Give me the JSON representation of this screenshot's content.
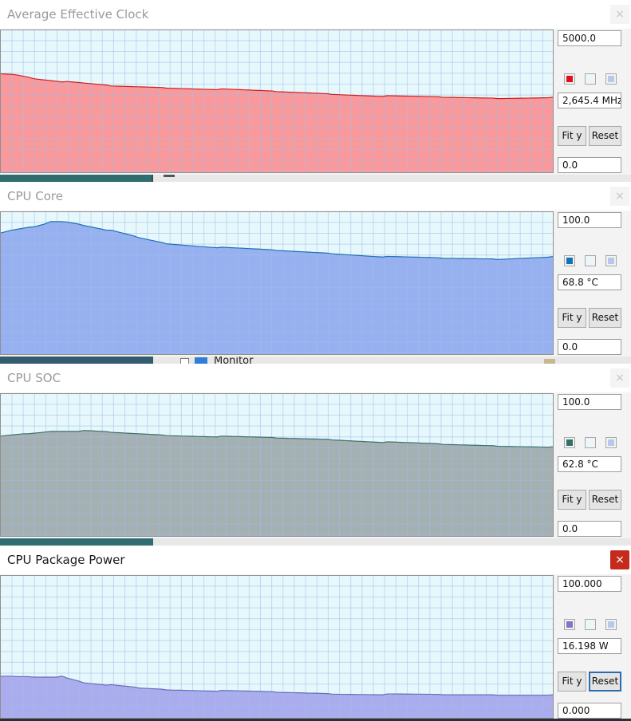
{
  "monitor_label": "Monitor",
  "panels": [
    {
      "title": "Average Effective Clock",
      "max_value": "5000.0",
      "current_value": "2,645.4 MHz",
      "min_value": "0.0",
      "fit_label": "Fit y",
      "reset_label": "Reset",
      "close_glyph": "×",
      "line_color": "#cc1f1f",
      "fill_color": "#fa999b",
      "swatch_color": "#e0101c",
      "active": false,
      "chart_data": {
        "type": "area",
        "ylim": [
          0,
          5000
        ],
        "x": [
          0,
          3,
          6,
          12,
          20,
          30,
          40,
          50,
          60,
          70,
          80,
          90,
          100
        ],
        "values": [
          3450,
          3425,
          3310,
          3180,
          3040,
          2980,
          2920,
          2840,
          2760,
          2680,
          2640,
          2610,
          2645
        ]
      }
    },
    {
      "title": "CPU Core",
      "max_value": "100.0",
      "current_value": "68.8 °C",
      "min_value": "0.0",
      "fit_label": "Fit y",
      "reset_label": "Reset",
      "close_glyph": "×",
      "line_color": "#1f6fb5",
      "fill_color": "#97b0f0",
      "swatch_color": "#0f73b6",
      "active": false,
      "chart_data": {
        "type": "area",
        "ylim": [
          0,
          100
        ],
        "x": [
          0,
          3,
          6,
          9,
          12,
          15,
          20,
          25,
          30,
          40,
          50,
          60,
          70,
          80,
          90,
          100
        ],
        "values": [
          85,
          88,
          90,
          93,
          93,
          91,
          87,
          82,
          78,
          75,
          73,
          71,
          68.5,
          67.5,
          67,
          68.8
        ]
      }
    },
    {
      "title": "CPU SOC",
      "max_value": "100.0",
      "current_value": "62.8 °C",
      "min_value": "0.0",
      "fit_label": "Fit y",
      "reset_label": "Reset",
      "close_glyph": "×",
      "line_color": "#3f6f68",
      "fill_color": "#a4b0b2",
      "swatch_color": "#2e7069",
      "active": false,
      "chart_data": {
        "type": "area",
        "ylim": [
          0,
          100
        ],
        "x": [
          0,
          5,
          10,
          15,
          20,
          30,
          40,
          50,
          60,
          70,
          80,
          90,
          100
        ],
        "values": [
          70,
          72,
          74,
          74,
          73,
          71,
          70,
          69,
          68,
          66,
          64.5,
          63.5,
          62.8
        ]
      }
    },
    {
      "title": "CPU Package Power",
      "max_value": "100.000",
      "current_value": "16.198 W",
      "min_value": "0.000",
      "fit_label": "Fit y",
      "reset_label": "Reset",
      "close_glyph": "×",
      "line_color": "#6a6ab8",
      "fill_color": "#abacee",
      "swatch_color": "#7e77c9",
      "active": true,
      "chart_data": {
        "type": "area",
        "ylim": [
          0,
          100
        ],
        "x": [
          0,
          3,
          6,
          11,
          12,
          15,
          20,
          25,
          30,
          40,
          50,
          60,
          70,
          80,
          90,
          100
        ],
        "values": [
          29,
          29,
          29,
          29,
          28,
          25,
          23,
          21,
          20,
          19,
          18,
          17,
          16.5,
          16.2,
          16.2,
          16.198
        ]
      }
    }
  ]
}
